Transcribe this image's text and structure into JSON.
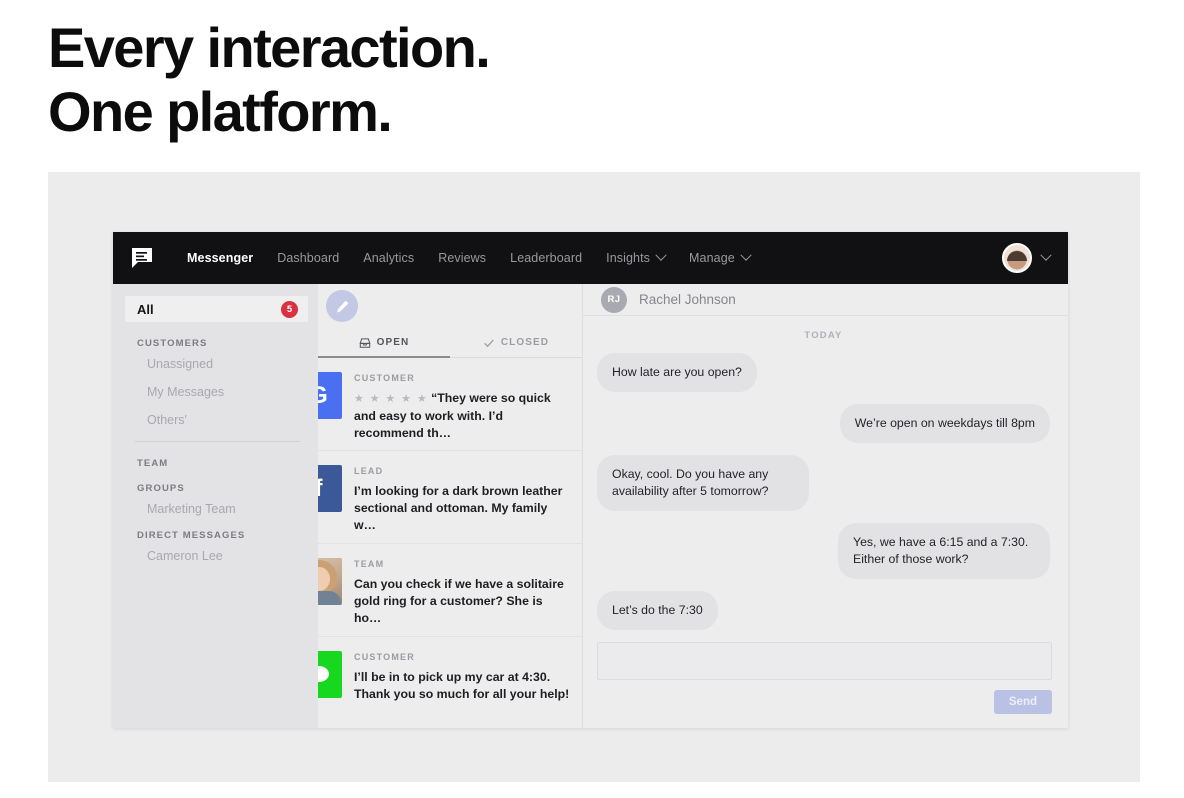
{
  "headline": {
    "line1": "Every interaction.",
    "line2": "One platform."
  },
  "colors": {
    "nav_bg": "#111113",
    "badge_red": "#d8313f",
    "google_blue": "#4a6ff0",
    "facebook_blue": "#3b5998",
    "sms_green": "#17d81e",
    "send_lavender": "#b9c2e4",
    "stage_gray": "#ececec"
  },
  "topnav": {
    "logo_icon": "messenger-bubble-logo",
    "items": [
      {
        "label": "Messenger",
        "active": true,
        "caret": false
      },
      {
        "label": "Dashboard",
        "active": false,
        "caret": false
      },
      {
        "label": "Analytics",
        "active": false,
        "caret": false
      },
      {
        "label": "Reviews",
        "active": false,
        "caret": false
      },
      {
        "label": "Leaderboard",
        "active": false,
        "caret": false
      },
      {
        "label": "Insights",
        "active": false,
        "caret": true
      },
      {
        "label": "Manage",
        "active": false,
        "caret": true
      }
    ],
    "account": {
      "avatar_icon": "user-avatar",
      "caret_icon": "chevron-down-icon"
    }
  },
  "sidebar": {
    "all": {
      "label": "All",
      "badge": "5"
    },
    "sections": [
      {
        "heading": "CUSTOMERS",
        "items": [
          "Unassigned",
          "My Messages",
          "Others'"
        ]
      },
      {
        "heading": "TEAM",
        "items": []
      },
      {
        "heading": "GROUPS",
        "items": [
          "Marketing Team"
        ]
      },
      {
        "heading": "DIRECT MESSAGES",
        "items": [
          "Cameron Lee"
        ]
      }
    ]
  },
  "conversations": {
    "compose_icon": "pencil-compose-icon",
    "tabs": [
      {
        "label": "OPEN",
        "icon": "inbox-icon",
        "active": true
      },
      {
        "label": "CLOSED",
        "icon": "checkmark-icon",
        "active": false
      }
    ],
    "items": [
      {
        "icon": "google-icon",
        "icon_glyph": "G",
        "channel": "google",
        "label": "CUSTOMER",
        "stars": "★ ★ ★ ★ ★",
        "text": "“They were so quick and easy to work with. I’d recommend th…"
      },
      {
        "icon": "facebook-icon",
        "icon_glyph": "f",
        "channel": "facebook",
        "label": "LEAD",
        "stars": "",
        "text": "I’m looking for a dark brown leather sectional and ottoman. My family w…"
      },
      {
        "icon": "team-member-photo",
        "icon_glyph": "",
        "channel": "photo",
        "label": "TEAM",
        "stars": "",
        "text": "Can you check if we have a solitaire gold ring for a customer? She is ho…"
      },
      {
        "icon": "sms-icon",
        "icon_glyph": "",
        "channel": "sms",
        "label": "CUSTOMER",
        "stars": "",
        "text": "I’ll be in to pick up my car at 4:30. Thank you so much for all your help!"
      }
    ]
  },
  "chat": {
    "contact": {
      "initials": "RJ",
      "name": "Rachel Johnson"
    },
    "day_divider": "TODAY",
    "messages": [
      {
        "direction": "in",
        "text": "How late are you open?"
      },
      {
        "direction": "out",
        "text": "We’re open on weekdays till 8pm"
      },
      {
        "direction": "in",
        "text": "Okay, cool. Do you have any availability after 5 tomorrow?"
      },
      {
        "direction": "out",
        "text": "Yes, we have a 6:15 and a 7:30. Either of those work?"
      },
      {
        "direction": "in",
        "text": "Let’s do the 7:30"
      }
    ],
    "composer": {
      "value": "",
      "placeholder": "",
      "send_label": "Send"
    }
  }
}
